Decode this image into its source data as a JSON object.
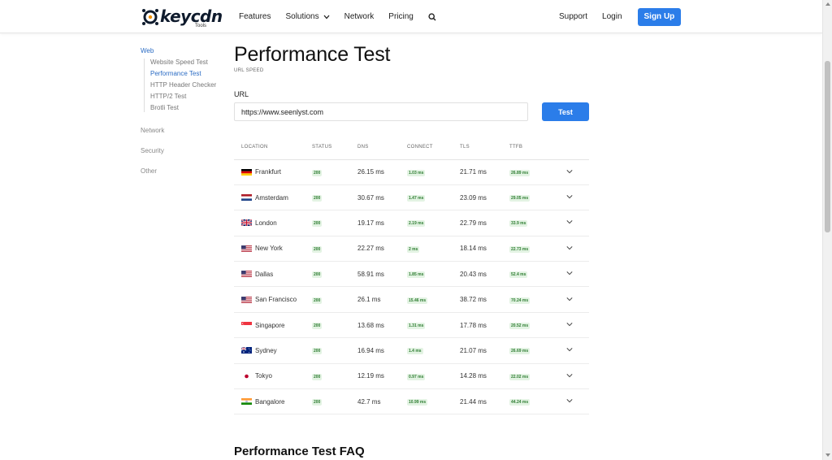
{
  "header": {
    "logo_text": "keycdn",
    "logo_sub": "Tools",
    "nav": [
      "Features",
      "Solutions",
      "Network",
      "Pricing"
    ],
    "support": "Support",
    "login": "Login",
    "signup": "Sign Up"
  },
  "sidebar": {
    "web": "Web",
    "web_items": [
      "Website Speed Test",
      "Performance Test",
      "HTTP Header Checker",
      "HTTP/2 Test",
      "Brotli Test"
    ],
    "network": "Network",
    "security": "Security",
    "other": "Other"
  },
  "main": {
    "title": "Performance Test",
    "subtitle": "URL SPEED",
    "url_label": "URL",
    "url_value": "https://www.seenlyst.com",
    "test_button": "Test",
    "columns": [
      "LOCATION",
      "STATUS",
      "DNS",
      "CONNECT",
      "TLS",
      "TTFB"
    ],
    "rows": [
      {
        "location": "Frankfurt",
        "flag": "de",
        "status": "200",
        "dns": "26.15 ms",
        "connect": "1.03 ms",
        "tls": "21.71 ms",
        "ttfb": "26.89 ms"
      },
      {
        "location": "Amsterdam",
        "flag": "nl",
        "status": "200",
        "dns": "30.67 ms",
        "connect": "1.47 ms",
        "tls": "23.09 ms",
        "ttfb": "29.05 ms"
      },
      {
        "location": "London",
        "flag": "gb",
        "status": "200",
        "dns": "19.17 ms",
        "connect": "2.19 ms",
        "tls": "22.79 ms",
        "ttfb": "33.9 ms"
      },
      {
        "location": "New York",
        "flag": "us",
        "status": "200",
        "dns": "22.27 ms",
        "connect": "2 ms",
        "tls": "18.14 ms",
        "ttfb": "22.73 ms"
      },
      {
        "location": "Dallas",
        "flag": "us",
        "status": "200",
        "dns": "58.91 ms",
        "connect": "1.85 ms",
        "tls": "20.43 ms",
        "ttfb": "52.4 ms"
      },
      {
        "location": "San Francisco",
        "flag": "us",
        "status": "200",
        "dns": "26.1 ms",
        "connect": "15.46 ms",
        "tls": "38.72 ms",
        "ttfb": "70.24 ms"
      },
      {
        "location": "Singapore",
        "flag": "sg",
        "status": "200",
        "dns": "13.68 ms",
        "connect": "1.31 ms",
        "tls": "17.78 ms",
        "ttfb": "20.52 ms"
      },
      {
        "location": "Sydney",
        "flag": "au",
        "status": "200",
        "dns": "16.94 ms",
        "connect": "1.4 ms",
        "tls": "21.07 ms",
        "ttfb": "26.69 ms"
      },
      {
        "location": "Tokyo",
        "flag": "jp",
        "status": "200",
        "dns": "12.19 ms",
        "connect": "0.97 ms",
        "tls": "14.28 ms",
        "ttfb": "22.02 ms"
      },
      {
        "location": "Bangalore",
        "flag": "in",
        "status": "200",
        "dns": "42.7 ms",
        "connect": "10.99 ms",
        "tls": "21.44 ms",
        "ttfb": "44.24 ms"
      }
    ],
    "faq_title": "Performance Test FAQ"
  },
  "colors": {
    "accent": "#2b7de9",
    "link": "#2b6cc4",
    "badge_bg": "#e3f3e3",
    "badge_text": "#2e7d32"
  }
}
